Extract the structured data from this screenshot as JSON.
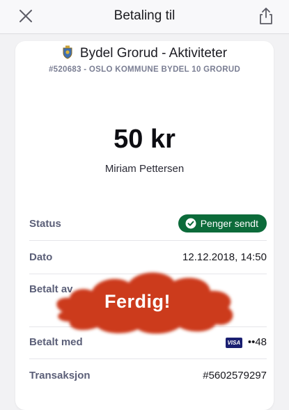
{
  "header": {
    "title": "Betaling til",
    "close_icon": "close-icon",
    "share_icon": "share-icon"
  },
  "merchant": {
    "name": "Bydel Grorud - Aktiviteter",
    "crest_icon": "coat-of-arms-icon",
    "subline": "#520683 - OSLO KOMMUNE BYDEL 10 GRORUD"
  },
  "payment": {
    "amount": "50 kr",
    "payer": "Miriam Pettersen"
  },
  "details": {
    "status_label": "Status",
    "status_value": "Penger sendt",
    "status_color": "#0c6b3a",
    "date_label": "Dato",
    "date_value": "12.12.2018, 14:50",
    "paid_by_label": "Betalt av",
    "paid_with_label": "Betalt med",
    "card_brand": "VISA",
    "card_last": "••48",
    "transaction_label": "Transaksjon",
    "transaction_value": "#5602579297"
  },
  "overlay": {
    "text": "Ferdig!",
    "color": "#cc3a1a"
  }
}
